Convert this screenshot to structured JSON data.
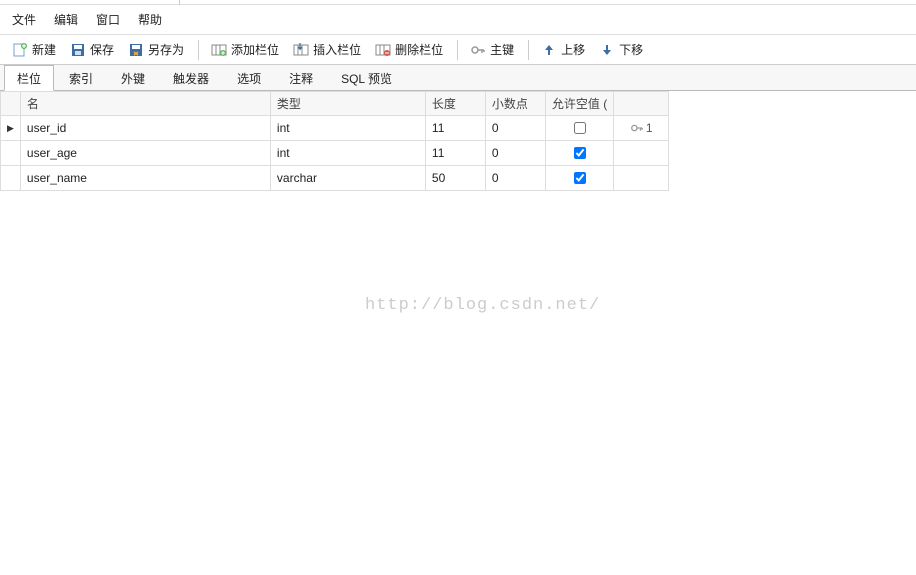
{
  "menu": {
    "file": "文件",
    "edit": "编辑",
    "window": "窗口",
    "help": "帮助"
  },
  "toolbar": {
    "new": "新建",
    "save": "保存",
    "saveas": "另存为",
    "addfield": "添加栏位",
    "insertfield": "插入栏位",
    "deletefield": "删除栏位",
    "primarykey": "主键",
    "moveup": "上移",
    "movedown": "下移"
  },
  "tabs": {
    "fields": "栏位",
    "indexes": "索引",
    "foreignkeys": "外键",
    "triggers": "触发器",
    "options": "选项",
    "comment": "注释",
    "sqlpreview": "SQL 预览"
  },
  "columns": {
    "name": "名",
    "type": "类型",
    "length": "长度",
    "decimal": "小数点",
    "nullable": "允许空值 ("
  },
  "rows": [
    {
      "current": true,
      "name": "user_id",
      "type": "int",
      "length": "11",
      "decimal": "0",
      "nullable": false,
      "pk": "1"
    },
    {
      "current": false,
      "name": "user_age",
      "type": "int",
      "length": "11",
      "decimal": "0",
      "nullable": true,
      "pk": ""
    },
    {
      "current": false,
      "name": "user_name",
      "type": "varchar",
      "length": "50",
      "decimal": "0",
      "nullable": true,
      "pk": ""
    }
  ],
  "watermark": "http://blog.csdn.net/"
}
